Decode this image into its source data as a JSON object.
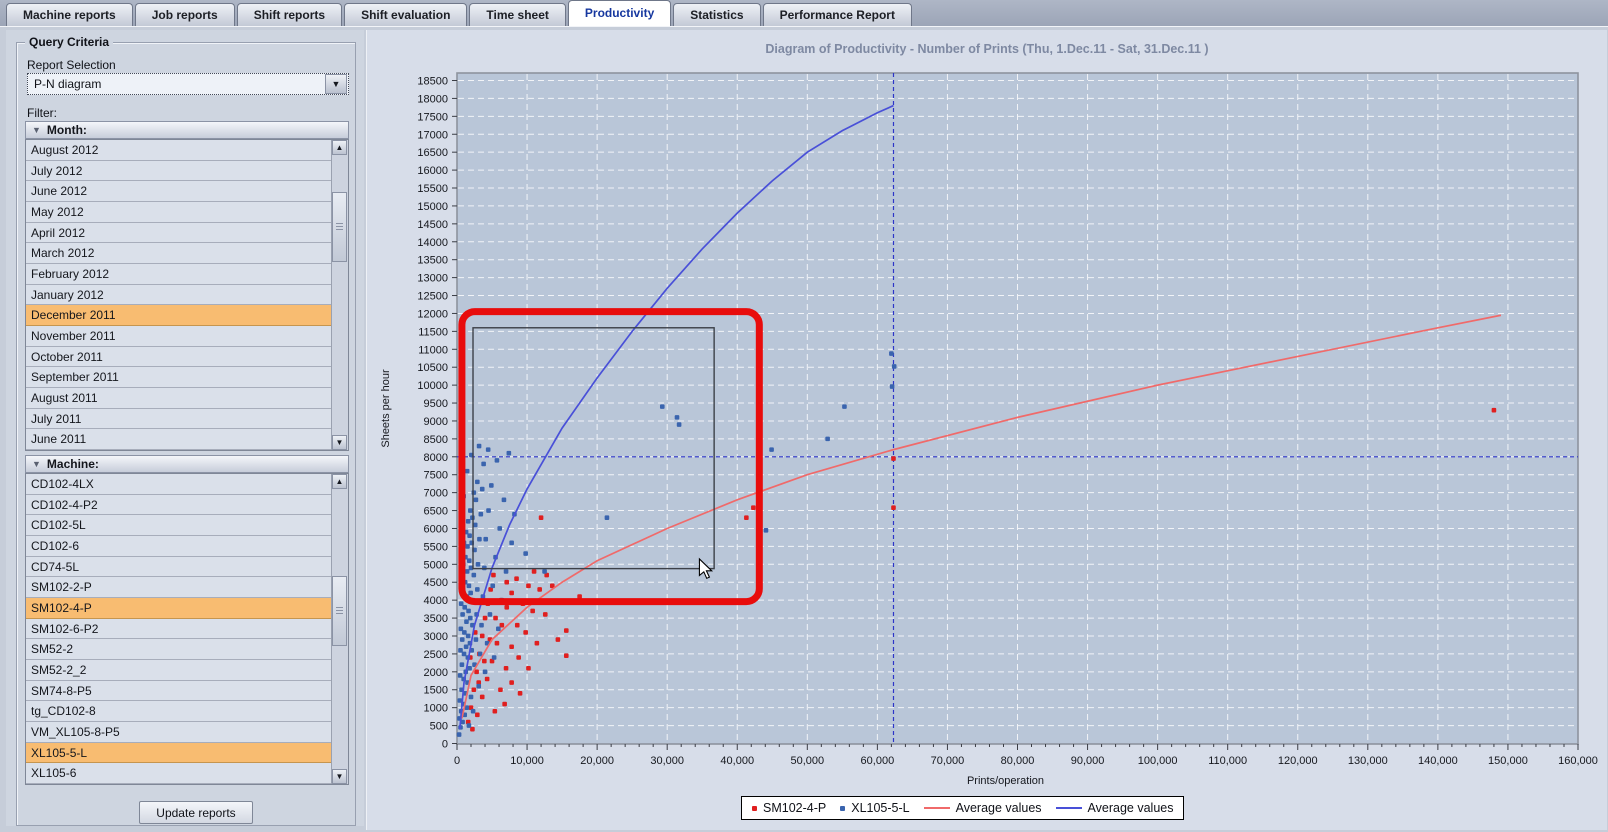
{
  "tabs": [
    {
      "label": "Machine reports",
      "active": false
    },
    {
      "label": "Job reports",
      "active": false
    },
    {
      "label": "Shift reports",
      "active": false
    },
    {
      "label": "Shift evaluation",
      "active": false
    },
    {
      "label": "Time sheet",
      "active": false
    },
    {
      "label": "Productivity",
      "active": true
    },
    {
      "label": "Statistics",
      "active": false
    },
    {
      "label": "Performance Report",
      "active": false
    }
  ],
  "query_panel": {
    "title": "Query Criteria",
    "report_selection_label": "Report Selection",
    "report_selection_value": "P-N diagram",
    "filter_label": "Filter:",
    "month_section": {
      "label": "Month:",
      "items": [
        "August 2012",
        "July 2012",
        "June 2012",
        "May 2012",
        "April 2012",
        "March 2012",
        "February 2012",
        "January 2012",
        "December 2011",
        "November 2011",
        "October 2011",
        "September 2011",
        "August 2011",
        "July 2011",
        "June 2011"
      ],
      "selected": [
        "December 2011"
      ]
    },
    "machine_section": {
      "label": "Machine:",
      "items": [
        "CD102-4LX",
        "CD102-4-P2",
        "CD102-5L",
        "CD102-6",
        "CD74-5L",
        "SM102-2-P",
        "SM102-4-P",
        "SM102-6-P2",
        "SM52-2",
        "SM52-2_2",
        "SM74-8-P5",
        "tg_CD102-8",
        "VM_XL105-8-P5",
        "XL105-5-L",
        "XL105-6"
      ],
      "selected": [
        "SM102-4-P",
        "XL105-5-L"
      ]
    },
    "update_button": "Update reports"
  },
  "chart_data": {
    "type": "scatter",
    "title": "Diagram of Productivity - Number of Prints   (Thu, 1.Dec.11  - Sat, 31.Dec.11 )",
    "xlabel": "Prints/operation",
    "ylabel": "Sheets per hour",
    "xlim": [
      0,
      160000
    ],
    "ylim": [
      0,
      18500
    ],
    "x_tick_step": 10000,
    "x_minor_step": 2000,
    "y_tick_step": 500,
    "grid": {
      "x_step": 10000,
      "y_step": 500,
      "color": "#ffffff",
      "style": "dashed"
    },
    "crosshair": {
      "x": 62300,
      "y": 8000,
      "color": "#2d35c8"
    },
    "series": [
      {
        "name": "SM102-4-P",
        "type": "scatter",
        "color": "#e01f1f",
        "points": [
          [
            1600,
            600
          ],
          [
            2000,
            1000
          ],
          [
            2400,
            1500
          ],
          [
            2800,
            2000
          ],
          [
            3200,
            2500
          ],
          [
            3600,
            3000
          ],
          [
            4000,
            3500
          ],
          [
            4400,
            3900
          ],
          [
            4800,
            4300
          ],
          [
            5200,
            4700
          ],
          [
            2200,
            400
          ],
          [
            2900,
            800
          ],
          [
            3600,
            1300
          ],
          [
            4300,
            1800
          ],
          [
            5000,
            2300
          ],
          [
            5700,
            2800
          ],
          [
            6400,
            3300
          ],
          [
            7100,
            3800
          ],
          [
            7800,
            4200
          ],
          [
            8500,
            4600
          ],
          [
            3100,
            1700
          ],
          [
            3900,
            2300
          ],
          [
            4700,
            2900
          ],
          [
            5500,
            3500
          ],
          [
            6300,
            4000
          ],
          [
            7100,
            4500
          ],
          [
            5400,
            900
          ],
          [
            6200,
            1500
          ],
          [
            7000,
            2100
          ],
          [
            7800,
            2700
          ],
          [
            8600,
            3300
          ],
          [
            9400,
            3900
          ],
          [
            10200,
            4400
          ],
          [
            11000,
            4800
          ],
          [
            6800,
            1100
          ],
          [
            7800,
            1700
          ],
          [
            8800,
            2400
          ],
          [
            9800,
            3100
          ],
          [
            10800,
            3700
          ],
          [
            11800,
            4300
          ],
          [
            12800,
            4700
          ],
          [
            9000,
            1400
          ],
          [
            10200,
            2100
          ],
          [
            11400,
            2800
          ],
          [
            12600,
            3600
          ],
          [
            13600,
            4400
          ],
          [
            2600,
            3100
          ],
          [
            1900,
            2400
          ],
          [
            14400,
            2900
          ],
          [
            15600,
            3150
          ],
          [
            15600,
            2450
          ],
          [
            12000,
            6300
          ],
          [
            17500,
            4100
          ],
          [
            41300,
            6300
          ],
          [
            42300,
            6580
          ],
          [
            62300,
            7950
          ],
          [
            62300,
            6580
          ],
          [
            148000,
            9300
          ]
        ]
      },
      {
        "name": "XL105-5-L",
        "type": "scatter",
        "color": "#3a64ae",
        "points": [
          [
            300,
            250
          ],
          [
            350,
            700
          ],
          [
            400,
            1200
          ],
          [
            450,
            1900
          ],
          [
            500,
            450
          ],
          [
            500,
            2600
          ],
          [
            550,
            3200
          ],
          [
            600,
            900
          ],
          [
            600,
            3900
          ],
          [
            650,
            1500
          ],
          [
            700,
            2200
          ],
          [
            700,
            4600
          ],
          [
            750,
            2900
          ],
          [
            800,
            600
          ],
          [
            800,
            3600
          ],
          [
            850,
            4300
          ],
          [
            900,
            1100
          ],
          [
            900,
            5000
          ],
          [
            950,
            1800
          ],
          [
            1000,
            2500
          ],
          [
            1000,
            5600
          ],
          [
            1050,
            3100
          ],
          [
            1100,
            800
          ],
          [
            1100,
            3800
          ],
          [
            1150,
            4500
          ],
          [
            1200,
            1400
          ],
          [
            1200,
            5200
          ],
          [
            1250,
            2000
          ],
          [
            1300,
            2700
          ],
          [
            1300,
            5900
          ],
          [
            1350,
            3400
          ],
          [
            1400,
            1000
          ],
          [
            1400,
            4100
          ],
          [
            1450,
            4800
          ],
          [
            1500,
            1700
          ],
          [
            1500,
            5500
          ],
          [
            1550,
            2400
          ],
          [
            1600,
            3000
          ],
          [
            1600,
            6200
          ],
          [
            1650,
            3700
          ],
          [
            1700,
            500
          ],
          [
            1700,
            4400
          ],
          [
            1750,
            5100
          ],
          [
            1800,
            2100
          ],
          [
            1800,
            5800
          ],
          [
            1850,
            2800
          ],
          [
            1900,
            3500
          ],
          [
            1900,
            6500
          ],
          [
            1950,
            4200
          ],
          [
            2000,
            1300
          ],
          [
            2000,
            4900
          ],
          [
            2100,
            5600
          ],
          [
            2100,
            2600
          ],
          [
            2200,
            3300
          ],
          [
            2200,
            6300
          ],
          [
            2300,
            4000
          ],
          [
            2300,
            900
          ],
          [
            2400,
            4700
          ],
          [
            2400,
            7000
          ],
          [
            2500,
            5400
          ],
          [
            2500,
            2200
          ],
          [
            2600,
            6100
          ],
          [
            2700,
            2900
          ],
          [
            2700,
            6800
          ],
          [
            2800,
            3600
          ],
          [
            2900,
            4300
          ],
          [
            2900,
            7300
          ],
          [
            3000,
            5000
          ],
          [
            3100,
            1600
          ],
          [
            3200,
            5700
          ],
          [
            3300,
            2500
          ],
          [
            3400,
            6400
          ],
          [
            3500,
            3300
          ],
          [
            3600,
            7100
          ],
          [
            3700,
            4100
          ],
          [
            3800,
            7800
          ],
          [
            3900,
            4900
          ],
          [
            4000,
            2000
          ],
          [
            4100,
            5700
          ],
          [
            4300,
            2800
          ],
          [
            4500,
            6500
          ],
          [
            4700,
            3600
          ],
          [
            4900,
            7200
          ],
          [
            5100,
            4400
          ],
          [
            5300,
            2400
          ],
          [
            5500,
            5200
          ],
          [
            5700,
            7900
          ],
          [
            5900,
            3200
          ],
          [
            6100,
            6000
          ],
          [
            6400,
            4000
          ],
          [
            6700,
            6800
          ],
          [
            7000,
            4800
          ],
          [
            7400,
            8100
          ],
          [
            7800,
            5600
          ],
          [
            8200,
            6400
          ],
          [
            2050,
            8050
          ],
          [
            1450,
            7600
          ],
          [
            950,
            6900
          ],
          [
            3150,
            8300
          ],
          [
            4450,
            8200
          ],
          [
            9800,
            5300
          ],
          [
            12500,
            4800
          ],
          [
            21400,
            6300
          ],
          [
            29300,
            9400
          ],
          [
            31400,
            9100
          ],
          [
            31700,
            8900
          ],
          [
            44900,
            8200
          ],
          [
            44100,
            5950
          ],
          [
            52900,
            8500
          ],
          [
            55300,
            9400
          ],
          [
            62000,
            10880
          ],
          [
            62400,
            10520
          ],
          [
            62100,
            9960
          ]
        ]
      },
      {
        "name": "Average values",
        "type": "line",
        "color": "#f06a6a",
        "points": [
          [
            700,
            700
          ],
          [
            2000,
            1900
          ],
          [
            5000,
            2900
          ],
          [
            10000,
            3800
          ],
          [
            15000,
            4500
          ],
          [
            20000,
            5100
          ],
          [
            30000,
            6000
          ],
          [
            40000,
            6800
          ],
          [
            50000,
            7500
          ],
          [
            62300,
            8200
          ],
          [
            80000,
            9100
          ],
          [
            100000,
            10000
          ],
          [
            120000,
            10800
          ],
          [
            140000,
            11600
          ],
          [
            149000,
            11950
          ]
        ]
      },
      {
        "name": "Average values",
        "type": "line",
        "color": "#4950d8",
        "points": [
          [
            400,
            400
          ],
          [
            1000,
            1700
          ],
          [
            2500,
            3300
          ],
          [
            5000,
            4900
          ],
          [
            7500,
            6100
          ],
          [
            10000,
            7100
          ],
          [
            15000,
            8800
          ],
          [
            20000,
            10200
          ],
          [
            25000,
            11500
          ],
          [
            30000,
            12700
          ],
          [
            35000,
            13800
          ],
          [
            40000,
            14800
          ],
          [
            45000,
            15700
          ],
          [
            50000,
            16500
          ],
          [
            55000,
            17100
          ],
          [
            60000,
            17600
          ],
          [
            62300,
            17800
          ]
        ]
      }
    ],
    "annotations": {
      "selection_highlight": {
        "x1": 700,
        "y1": 3960,
        "x2": 43150,
        "y2": 12050,
        "color": "#e80c0c"
      },
      "selection_rect": {
        "x1": 2285,
        "y1": 4880,
        "x2": 36700,
        "y2": 11600,
        "color": "#3c4048"
      },
      "cursor": {
        "x": 34600,
        "y": 5150
      }
    },
    "legend": [
      {
        "label": "SM102-4-P",
        "marker": "point",
        "color": "#e01f1f"
      },
      {
        "label": "XL105-5-L",
        "marker": "point",
        "color": "#3a64ae"
      },
      {
        "label": "Average values",
        "marker": "line",
        "color": "#f06a6a"
      },
      {
        "label": "Average values",
        "marker": "line",
        "color": "#4950d8"
      }
    ]
  }
}
